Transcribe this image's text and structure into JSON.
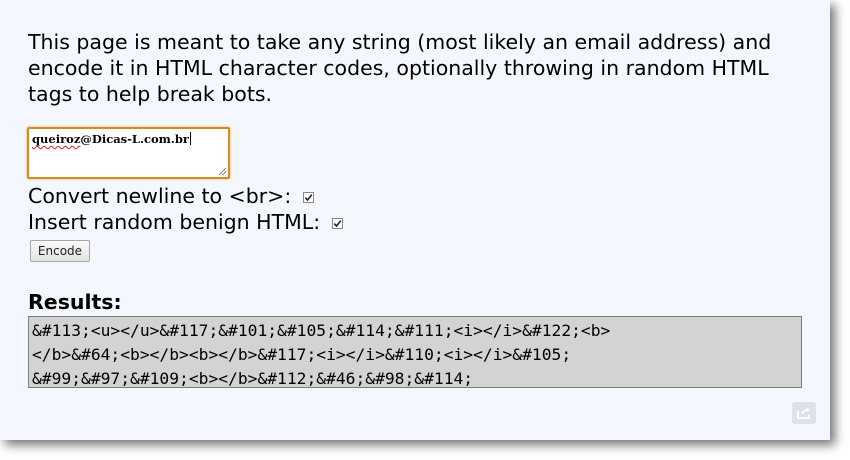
{
  "intro_text": "This page is meant to take any string (most likely an email address) and encode it in HTML character codes, optionally throwing in random HTML tags to help break bots.",
  "input": {
    "value_underlined": "queiroz",
    "value_rest": "@Dicas-L.com.br"
  },
  "options": {
    "newline_label": "Convert newline to <br>:",
    "newline_checked": true,
    "random_html_label": "Insert random benign HTML:",
    "random_html_checked": true
  },
  "encode_button_label": "Encode",
  "results": {
    "heading": "Results:",
    "lines": [
      "&#113;<u></u>&#117;&#101;&#105;&#114;&#111;<i></i>&#122;<b>",
      "</b>&#64;<b></b><b></b>&#117;<i></i>&#110;<i></i>&#105;",
      "&#99;&#97;&#109;<b></b>&#112;&#46;&#98;&#114;"
    ]
  },
  "icons": {
    "share": "share-icon",
    "checkbox": "checkmark-icon"
  },
  "colors": {
    "page_background": "#f4f7fd",
    "input_focus_border": "#d98a1c",
    "results_background": "#d3d3d3"
  }
}
